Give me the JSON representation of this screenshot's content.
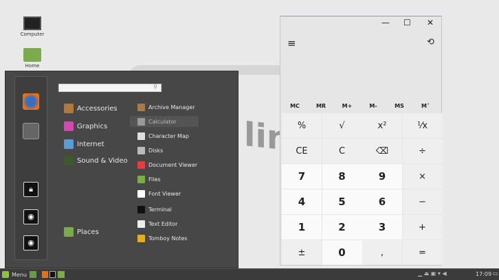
{
  "desktop": {
    "icons": [
      {
        "label": "Computer"
      },
      {
        "label": "Home"
      }
    ],
    "logo_text": "linux"
  },
  "menu": {
    "search_placeholder": "",
    "categories": [
      {
        "label": "Accessories",
        "color": "#b07a3c"
      },
      {
        "label": "Graphics",
        "color": "#d24ab0"
      },
      {
        "label": "Internet",
        "color": "#5c9bd6"
      },
      {
        "label": "Sound & Video",
        "color": "#3c5a2c"
      }
    ],
    "places": {
      "label": "Places"
    },
    "apps": [
      {
        "label": "Archive Manager",
        "color": "#a57c4c"
      },
      {
        "label": "Calculator",
        "color": "#999999"
      },
      {
        "label": "Character Map",
        "color": "#dddddd"
      },
      {
        "label": "Disks",
        "color": "#bbbbbb"
      },
      {
        "label": "Document Viewer",
        "color": "#e04040"
      },
      {
        "label": "Files",
        "color": "#7cab4c"
      },
      {
        "label": "Font Viewer",
        "color": "#ffffff"
      },
      {
        "label": "Terminal",
        "color": "#111111"
      },
      {
        "label": "Text Editor",
        "color": "#eeeeee"
      },
      {
        "label": "Tomboy Notes",
        "color": "#e0b020"
      }
    ],
    "hovered_app": "Calculator"
  },
  "calculator": {
    "window": {
      "minimize": "—",
      "maximize": "☐",
      "close": "✕"
    },
    "menu_icon": "≡",
    "history_icon": "⟲",
    "memory": [
      "MC",
      "MR",
      "M+",
      "M-",
      "MS",
      "M˅"
    ],
    "keys": [
      [
        "%",
        "√",
        "x²",
        "⅟x"
      ],
      [
        "CE",
        "C",
        "⌫",
        "÷"
      ],
      [
        "7",
        "8",
        "9",
        "×"
      ],
      [
        "4",
        "5",
        "6",
        "−"
      ],
      [
        "1",
        "2",
        "3",
        "+"
      ],
      [
        "±",
        "0",
        ",",
        "="
      ]
    ]
  },
  "taskbar": {
    "menu_label": "Menu",
    "clock": "17:09"
  }
}
